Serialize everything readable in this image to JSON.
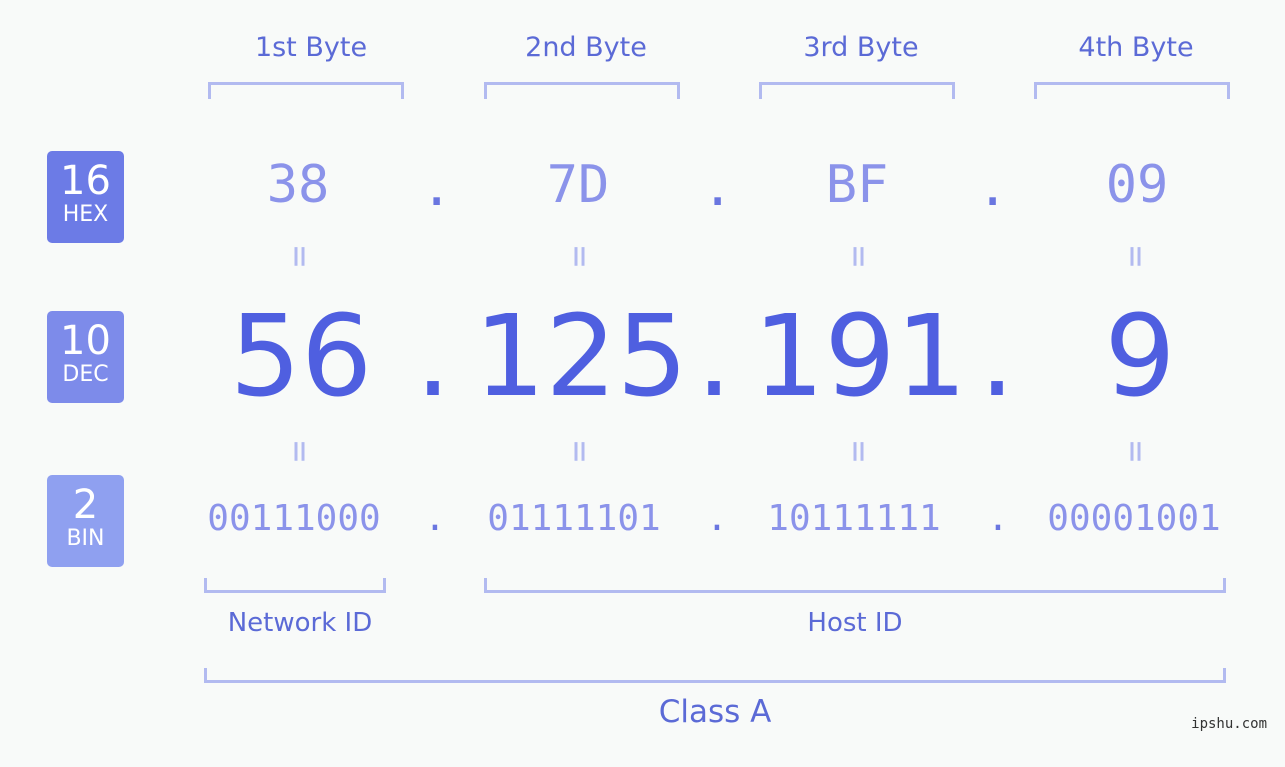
{
  "byte_headers": [
    "1st Byte",
    "2nd Byte",
    "3rd Byte",
    "4th Byte"
  ],
  "badges": {
    "hex": {
      "num": "16",
      "label": "HEX",
      "color": "#6c7be6"
    },
    "dec": {
      "num": "10",
      "label": "DEC",
      "color": "#7d8bea"
    },
    "bin": {
      "num": "2",
      "label": "BIN",
      "color": "#8fa0f0"
    }
  },
  "hex": [
    "38",
    "7D",
    "BF",
    "09"
  ],
  "dec": [
    "56",
    "125",
    "191",
    "9"
  ],
  "bin": [
    "00111000",
    "01111101",
    "10111111",
    "00001001"
  ],
  "separator": ".",
  "equals": "=",
  "network_id_label": "Network ID",
  "host_id_label": "Host ID",
  "class_label": "Class A",
  "watermark": "ipshu.com"
}
